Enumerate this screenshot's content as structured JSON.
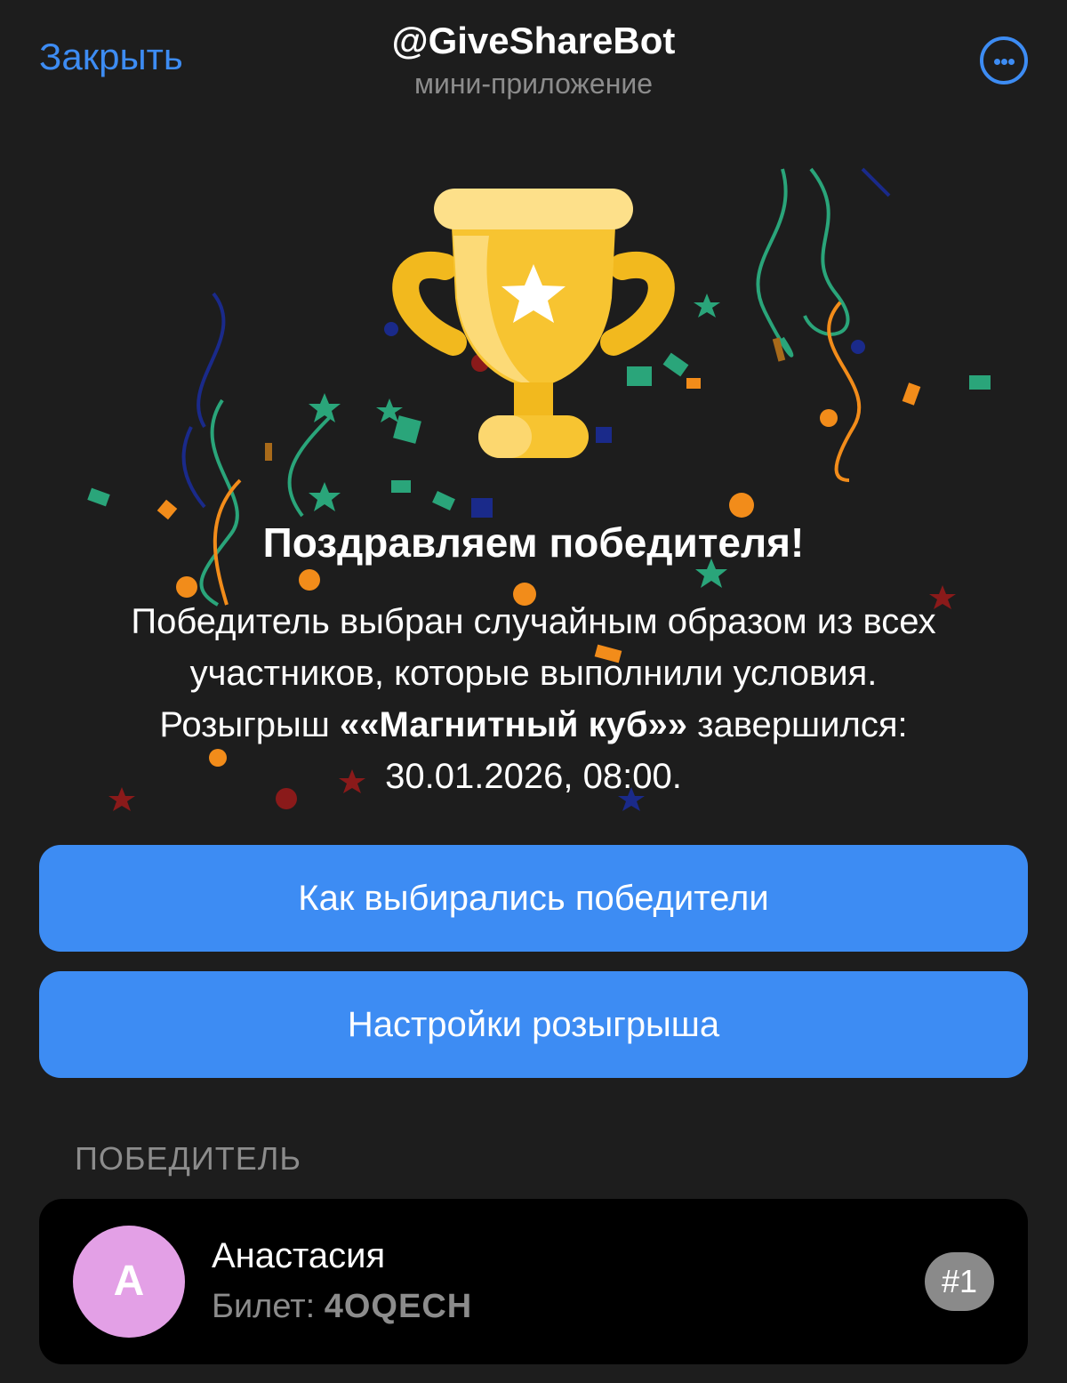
{
  "header": {
    "close_label": "Закрыть",
    "bot_name": "@GiveShareBot",
    "bot_subtitle": "мини-приложение",
    "more_icon": "more-dots-icon"
  },
  "hero": {
    "icon": "trophy-icon",
    "headline": "Поздравляем победителя!",
    "desc_line1": "Победитель выбран случайным образом из всех",
    "desc_line2": "участников, которые выполнили условия.",
    "desc_line3_prefix": "Розыгрыш ",
    "giveaway_name": "««Магнитный куб»»",
    "desc_line3_suffix": " завершился:",
    "end_datetime": "30.01.2026, 08:00."
  },
  "actions": {
    "how_winners_label": "Как выбирались победители",
    "settings_label": "Настройки розыгрыша"
  },
  "winners": {
    "section_title": "ПОБЕДИТЕЛЬ",
    "items": [
      {
        "avatar_letter": "А",
        "name": "Анастасия",
        "ticket_label": "Билет: ",
        "ticket_code": "4OQECH",
        "rank": "#1"
      }
    ]
  },
  "colors": {
    "background": "#1d1d1d",
    "accent": "#3d8cf3",
    "card": "#000000",
    "avatar": "#e3a0e6",
    "muted": "#8c8c8c",
    "trophy": "#f7c431"
  }
}
